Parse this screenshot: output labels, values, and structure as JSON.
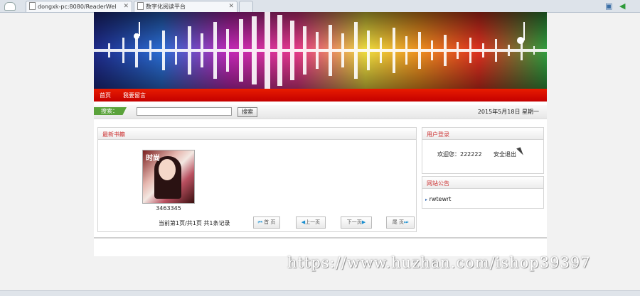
{
  "browser": {
    "tabs": [
      {
        "title": "dongxk-pc:8080/ReaderWel"
      },
      {
        "title": "数字化阅读平台"
      }
    ]
  },
  "site": {
    "nav": [
      "首页",
      "我要留言"
    ],
    "search": {
      "label": "搜索：",
      "button": "搜索",
      "value": ""
    },
    "date": "2015年5月18日 星期一"
  },
  "latest_books": {
    "title": "最新书籍",
    "book": {
      "title": "3463345",
      "cover_text": "时尚"
    },
    "pager": {
      "status": "当前第1页/共1页  共1条记录",
      "first": "首 页",
      "prev": "上一页",
      "next": "下一页",
      "last": "尾 页"
    }
  },
  "user_login": {
    "title": "用户登录",
    "welcome": "欢迎您：222222",
    "logout": "安全退出"
  },
  "announcement": {
    "title": "网站公告",
    "items": [
      "rwtewrt"
    ]
  },
  "watermark": "https://www.huzhan.com/ishop39397",
  "colors": {
    "nav_red": "#d80c00",
    "search_green": "#5aa23a",
    "panel_title": "#cc3333"
  }
}
